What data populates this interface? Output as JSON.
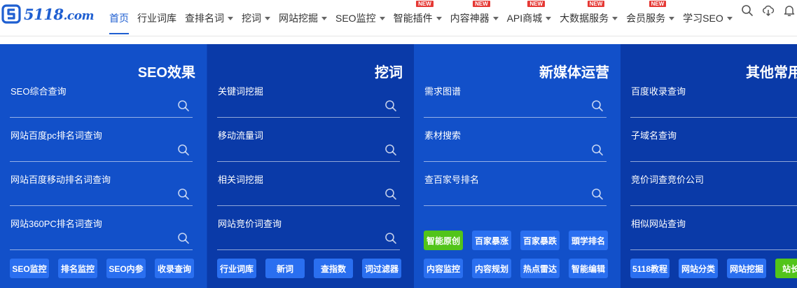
{
  "brand": {
    "logo_text": "5118",
    "logo_suffix": ".com"
  },
  "nav": {
    "items": [
      {
        "label": "首页",
        "active": true,
        "caret": false,
        "new": false
      },
      {
        "label": "行业词库",
        "active": false,
        "caret": false,
        "new": false
      },
      {
        "label": "查排名词",
        "active": false,
        "caret": true,
        "new": false
      },
      {
        "label": "挖词",
        "active": false,
        "caret": true,
        "new": false
      },
      {
        "label": "网站挖掘",
        "active": false,
        "caret": true,
        "new": false
      },
      {
        "label": "SEO监控",
        "active": false,
        "caret": true,
        "new": false
      },
      {
        "label": "智能插件",
        "active": false,
        "caret": true,
        "new": true
      },
      {
        "label": "内容神器",
        "active": false,
        "caret": true,
        "new": true
      },
      {
        "label": "API商城",
        "active": false,
        "caret": true,
        "new": true
      },
      {
        "label": "大数据服务",
        "active": false,
        "caret": true,
        "new": true
      },
      {
        "label": "会员服务",
        "active": false,
        "caret": true,
        "new": true
      },
      {
        "label": "学习SEO",
        "active": false,
        "caret": true,
        "new": false
      }
    ],
    "new_badge": "NEW",
    "icons": [
      "search-icon",
      "cloud-download-icon",
      "bell-icon"
    ]
  },
  "colors": {
    "brand": "#1f5fd1",
    "panel_button": "#2a6ff0",
    "green_button": "#52c41a",
    "badge_red": "#e53935"
  },
  "panels": [
    {
      "title": "SEO效果",
      "searches": [
        "SEO综合查询",
        "网站百度pc排名词查询",
        "网站百度移动排名词查询",
        "网站360PC排名词查询"
      ],
      "buttons": [
        [
          "SEO监控",
          "排名监控",
          "SEO内参",
          "收录查询"
        ]
      ]
    },
    {
      "title": "挖词",
      "searches": [
        "关键词挖掘",
        "移动流量词",
        "相关词挖掘",
        "网站竞价词查询"
      ],
      "buttons": [
        [
          "行业词库",
          "新词",
          "查指数",
          "词过滤器"
        ]
      ]
    },
    {
      "title": "新媒体运营",
      "searches": [
        "需求图谱",
        "素材搜索",
        "查百家号排名"
      ],
      "buttons": [
        [
          "智能原创",
          "百家暴涨",
          "百家暴跌",
          "頭学排名"
        ],
        [
          "内容监控",
          "内容规划",
          "热点雷达",
          "智能编辑"
        ]
      ]
    },
    {
      "title": "其他常用工",
      "searches": [
        "百度收录查询",
        "子域名查询",
        "竞价词查竞价公司",
        "相似网站查询"
      ],
      "buttons": [
        [
          "5118教程",
          "网站分类",
          "网站挖掘",
          "站长工"
        ]
      ]
    }
  ]
}
